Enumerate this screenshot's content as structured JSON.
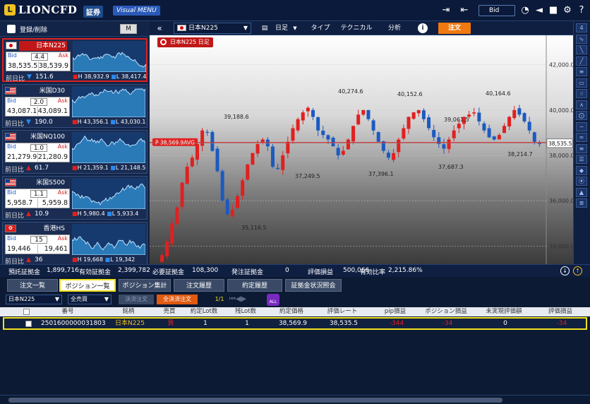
{
  "header": {
    "logo_mark": "L",
    "logo_text": "LIONCFD",
    "logo_badge": "証券",
    "menu_button": "Visual MENU",
    "price_type": "Bid"
  },
  "left_panel": {
    "register_label": "登録/削除",
    "cards": [
      {
        "name": "日本N225",
        "bid_label": "Bid",
        "ask_label": "Ask",
        "spread": "4.4",
        "bid": "38,535.5",
        "ask": "38,539.9",
        "change_label": "前日比",
        "change": "151.6",
        "direction": "down",
        "high": "H 38,932.9",
        "low": "L 38,417.4"
      },
      {
        "name": "米国D30",
        "bid_label": "Bid",
        "ask_label": "Ask",
        "spread": "2.0",
        "bid": "43,087.1",
        "ask": "43,089.1",
        "change_label": "前日比",
        "change": "190.0",
        "direction": "down",
        "high": "H 43,356.1",
        "low": "L 43,030.1"
      },
      {
        "name": "米国NQ100",
        "bid_label": "Bid",
        "ask_label": "Ask",
        "spread": "1.0",
        "bid": "21,279.9",
        "ask": "21,280.9",
        "change_label": "前日比",
        "change": "61.7",
        "direction": "up",
        "high": "H 21,359.1",
        "low": "L 21,148.5"
      },
      {
        "name": "米国S500",
        "bid_label": "Bid",
        "ask_label": "Ask",
        "spread": "1.1",
        "bid": "5,958.7",
        "ask": "5,959.8",
        "change_label": "前日比",
        "change": "10.9",
        "direction": "up",
        "high": "H 5,980.4",
        "low": "L 5,933.4"
      },
      {
        "name": "香港HS",
        "bid_label": "Bid",
        "ask_label": "Ask",
        "spread": "15",
        "bid": "19,446",
        "ask": "19,461",
        "change_label": "前日比",
        "change": "36",
        "direction": "up",
        "high": "H 19,668",
        "low": "L 19,342"
      }
    ]
  },
  "chart_toolbar": {
    "symbol": "日本N225",
    "period": "日足",
    "type": "タイプ",
    "technical": "テクニカル",
    "analysis": "分析",
    "info": "i",
    "order": "注文"
  },
  "chart_data": {
    "type": "candlestick",
    "title": "日本N225 日足",
    "y_ticks": [
      "42,000.0",
      "40,000.0",
      "38,000.0",
      "36,000.0",
      "34,000.0"
    ],
    "ylim": [
      33200,
      43300
    ],
    "last_price": "38,535.5",
    "avg_label": "38,569.9AVG",
    "avg_price": 38569.9,
    "annotations": [
      "39,188.6",
      "40,274.6",
      "40,152.6",
      "39,061.5",
      "40,164.6",
      "37,249.5",
      "37,396.1",
      "37,687.3",
      "38,214.7",
      "35,116.5"
    ],
    "closes": [
      33600,
      34200,
      35000,
      35700,
      36800,
      37500,
      37900,
      38500,
      39100,
      39000,
      38200,
      37300,
      36000,
      35400,
      35600,
      36200,
      36900,
      37600,
      38100,
      38500,
      38700,
      38400,
      37500,
      37400,
      38000,
      38600,
      39200,
      39600,
      39900,
      40100,
      39700,
      39100,
      38900,
      38700,
      38400,
      38000,
      38200,
      38700,
      39300,
      39800,
      40000,
      39600,
      39100,
      38600,
      38200,
      37900,
      38100,
      38700,
      39200,
      39700,
      39900,
      40000,
      39600,
      39200,
      38800,
      38500,
      38300,
      38700,
      39100,
      39400,
      39700,
      39800,
      39900,
      39500,
      39100,
      38800,
      38700,
      38900,
      39300,
      39700,
      40000,
      39800,
      39500,
      39100,
      38600,
      38500
    ]
  },
  "summary": {
    "items": [
      {
        "label": "預託証拠金",
        "value": "1,899,716"
      },
      {
        "label": "有効証拠金",
        "value": "2,399,782"
      },
      {
        "label": "必要証拠金",
        "value": "108,300"
      },
      {
        "label": "発注証拠金",
        "value": "0"
      },
      {
        "label": "評価損益",
        "value": "500,066"
      },
      {
        "label": "有効比率",
        "value": "2,215.86%"
      }
    ]
  },
  "tabs": [
    "注文一覧",
    "ポジション一覧",
    "ポジション集計",
    "注文履歴",
    "約定履歴",
    "証拠金状況照会"
  ],
  "filters": {
    "symbol": "日本N225",
    "side": "全売買",
    "settle_button": "決済注文",
    "settle_all_button": "全決済注文",
    "page": "1/1",
    "all_icon": "ALL"
  },
  "table": {
    "headers": [
      "番号",
      "銘柄",
      "売買",
      "約定Lot数",
      "残Lot数",
      "約定価格",
      "評価レート",
      "pip損益",
      "ポジション損益",
      "未実現評価額",
      "評価損益"
    ],
    "rows": [
      {
        "id": "2501600000031803",
        "symbol": "日本N225",
        "side": "買",
        "lots": "1",
        "remaining": "1",
        "price": "38,569.9",
        "rate": "38,535.5",
        "pip": "-344",
        "pl": "-34",
        "unrealized": "0",
        "eval": "-34"
      }
    ]
  },
  "colors": {
    "up": "#e02020",
    "down": "#1c5ac0",
    "accent": "#f07a10",
    "highlight": "#f0e020"
  }
}
